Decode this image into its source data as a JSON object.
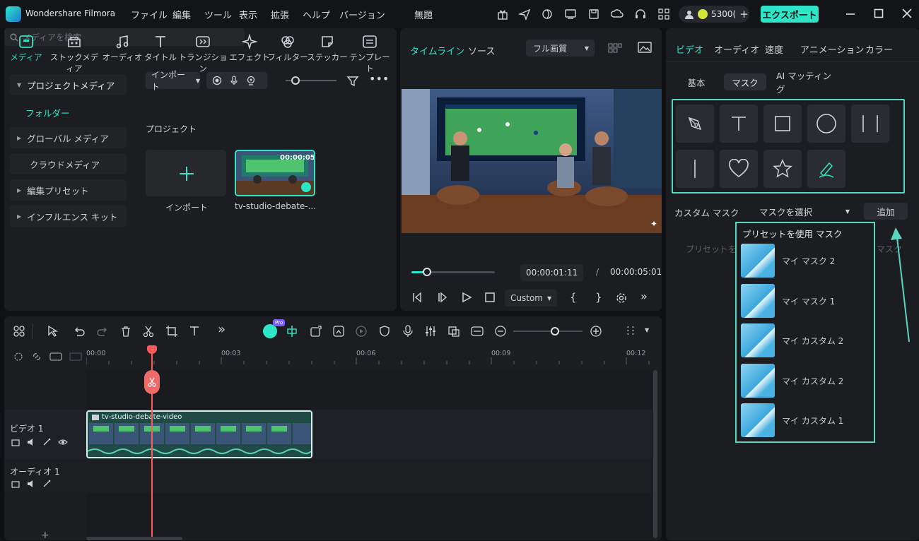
{
  "app": {
    "name": "Wondershare Filmora",
    "title": "無題"
  },
  "menu": [
    "ファイル",
    "編集",
    "ツール",
    "表示",
    "拡張",
    "ヘルプ",
    "バージョン"
  ],
  "header": {
    "credits": "5300(",
    "export_label": "エクスポート"
  },
  "media_tabs": [
    "メディア",
    "ストックメディア",
    "オーディオ",
    "タイトル",
    "トランジション",
    "エフェクト",
    "フィルター",
    "ステッカー",
    "テンプレート"
  ],
  "sidebar": {
    "project_media": "プロジェクトメディア",
    "folder": "フォルダー",
    "global_media": "グローバル メディア",
    "cloud_media": "クラウドメディア",
    "edit_preset": "編集プリセット",
    "influence_kit": "インフルエンス キット"
  },
  "media": {
    "import_label": "インポート",
    "search_placeholder": "メディアを検索",
    "section": "プロジェクト",
    "import_tile_label": "インポート",
    "clip_label": "tv-studio-debate-...",
    "clip_time": "00:00:05"
  },
  "preview": {
    "tab_timeline": "タイムライン",
    "tab_source": "ソース",
    "quality": "フル画質",
    "current_time": "00:00:01:11",
    "total_time": "00:00:05:01",
    "separator": "/",
    "speed": "Custom",
    "progress": 0.19
  },
  "properties": {
    "tabs": [
      "ビデオ",
      "オーディオ",
      "速度",
      "アニメーション",
      "カラー"
    ],
    "subtabs": [
      "基本",
      "マスク",
      "AI マッティング"
    ],
    "custom_mask_label": "カスタム マスク",
    "mask_select": "マスクを選択",
    "add_button": "追加",
    "preset_header": "プリセットを使用 マスク",
    "hidden_hint_left": "プリセットを使",
    "hidden_hint_right": "マスク",
    "presets": [
      "マイ マスク 2",
      "マイ マスク 1",
      "マイ カスタム 2",
      "マイ カスタム 2",
      "マイ カスタム 1"
    ]
  },
  "timeline": {
    "ruler": [
      "00:00",
      "00:03",
      "00:06",
      "00:09",
      "00:12"
    ],
    "video_track": "ビデオ 1",
    "audio_track": "オーディオ 1",
    "clip_name": "tv-studio-debate-video",
    "ai_badge": "Pro",
    "zoom": 0.6
  }
}
